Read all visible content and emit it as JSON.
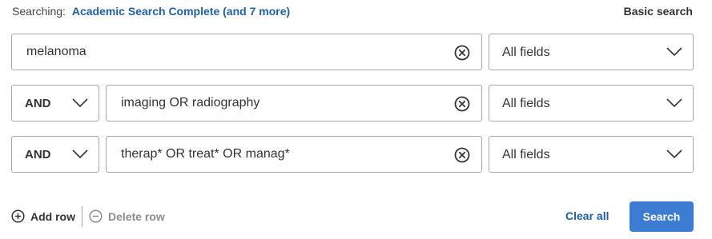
{
  "header": {
    "searching_label": "Searching:",
    "databases_link": "Academic Search Complete (and 7 more)",
    "basic_search_link": "Basic search"
  },
  "rows": [
    {
      "term": "melanoma",
      "field": "All fields"
    },
    {
      "operator": "AND",
      "term": "imaging OR radiography",
      "field": "All fields"
    },
    {
      "operator": "AND",
      "term": "therap* OR treat* OR manag*",
      "field": "All fields"
    }
  ],
  "footer": {
    "add_row": "Add row",
    "delete_row": "Delete row",
    "clear_all": "Clear all",
    "search_button": "Search"
  },
  "colors": {
    "link": "#1f5fa8",
    "primary_button": "#3c7dd3",
    "disabled_text": "#8c8c8c",
    "border": "#a9a9a9"
  },
  "icons": {
    "clear": "circle-x-icon",
    "dropdown": "chevron-down-icon",
    "add": "plus-circle-icon",
    "delete": "minus-circle-icon"
  }
}
